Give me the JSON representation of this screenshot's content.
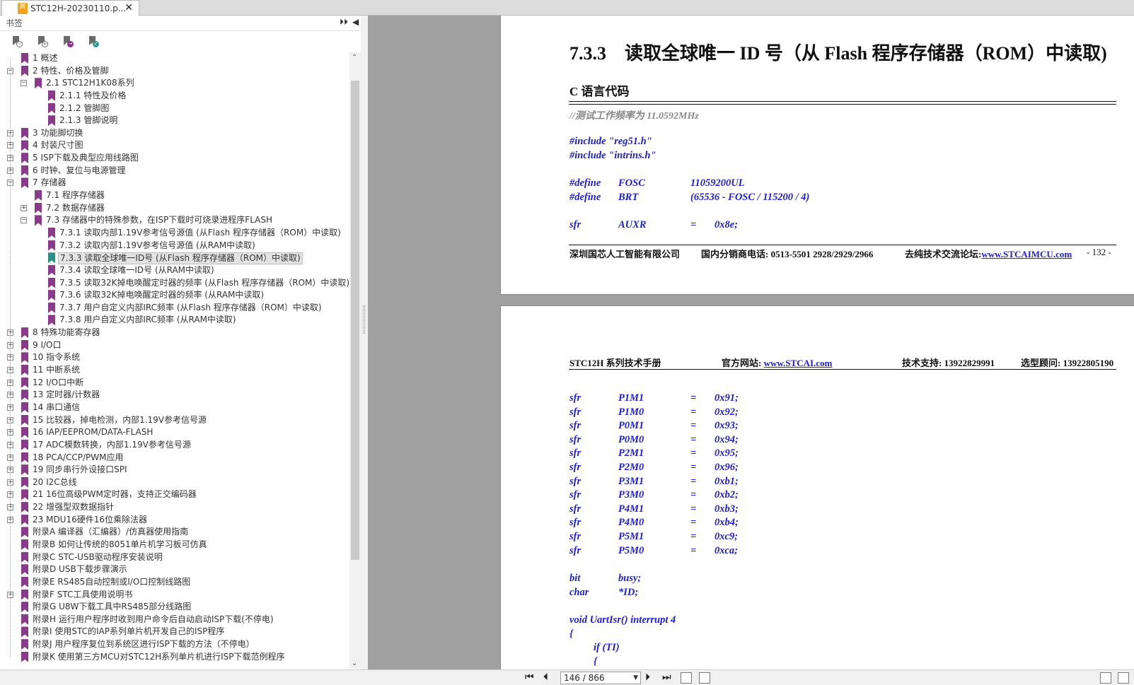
{
  "tab": {
    "title": "STC12H-20230110.p...",
    "icon": "pdf-icon"
  },
  "sidebar": {
    "title": "书签",
    "tree": [
      {
        "label": "1 概述",
        "level": 0,
        "exp": ""
      },
      {
        "label": "2 特性、价格及管脚",
        "level": 0,
        "exp": "−"
      },
      {
        "label": "2.1 STC12H1K08系列",
        "level": 1,
        "exp": "−"
      },
      {
        "label": "2.1.1 特性及价格",
        "level": 2,
        "exp": ""
      },
      {
        "label": "2.1.2 管脚图",
        "level": 2,
        "exp": ""
      },
      {
        "label": "2.1.3 管脚说明",
        "level": 2,
        "exp": ""
      },
      {
        "label": "3 功能脚切换",
        "level": 0,
        "exp": "+"
      },
      {
        "label": "4 封装尺寸图",
        "level": 0,
        "exp": "+"
      },
      {
        "label": "5 ISP下载及典型应用线路图",
        "level": 0,
        "exp": "+"
      },
      {
        "label": "6 时钟、复位与电源管理",
        "level": 0,
        "exp": "+"
      },
      {
        "label": "7 存储器",
        "level": 0,
        "exp": "−"
      },
      {
        "label": "7.1 程序存储器",
        "level": 1,
        "exp": ""
      },
      {
        "label": "7.2 数据存储器",
        "level": 1,
        "exp": "+"
      },
      {
        "label": "7.3 存储器中的特殊参数，在ISP下载时可烧录进程序FLASH",
        "level": 1,
        "exp": "−"
      },
      {
        "label": "7.3.1 读取内部1.19V参考信号源值 (从Flash 程序存储器（ROM）中读取)",
        "level": 2,
        "exp": ""
      },
      {
        "label": "7.3.2 读取内部1.19V参考信号源值 (从RAM中读取)",
        "level": 2,
        "exp": ""
      },
      {
        "label": "7.3.3 读取全球唯一ID号 (从Flash 程序存储器（ROM）中读取)",
        "level": 2,
        "exp": "",
        "selected": true
      },
      {
        "label": "7.3.4 读取全球唯一ID号 (从RAM中读取)",
        "level": 2,
        "exp": ""
      },
      {
        "label": "7.3.5 读取32K掉电唤醒定时器的频率 (从Flash 程序存储器（ROM）中读取)",
        "level": 2,
        "exp": ""
      },
      {
        "label": "7.3.6 读取32K掉电唤醒定时器的频率 (从RAM中读取)",
        "level": 2,
        "exp": ""
      },
      {
        "label": "7.3.7 用户自定义内部IRC频率 (从Flash 程序存储器（ROM）中读取)",
        "level": 2,
        "exp": ""
      },
      {
        "label": "7.3.8 用户自定义内部IRC频率 (从RAM中读取)",
        "level": 2,
        "exp": ""
      },
      {
        "label": "8 特殊功能寄存器",
        "level": 0,
        "exp": "+"
      },
      {
        "label": "9 I/O口",
        "level": 0,
        "exp": "+"
      },
      {
        "label": "10 指令系统",
        "level": 0,
        "exp": "+"
      },
      {
        "label": "11 中断系统",
        "level": 0,
        "exp": "+"
      },
      {
        "label": "12 I/O口中断",
        "level": 0,
        "exp": "+"
      },
      {
        "label": "13 定时器/计数器",
        "level": 0,
        "exp": "+"
      },
      {
        "label": "14 串口通信",
        "level": 0,
        "exp": "+"
      },
      {
        "label": "15 比较器，掉电检测，内部1.19V参考信号源",
        "level": 0,
        "exp": "+"
      },
      {
        "label": "16 IAP/EEPROM/DATA-FLASH",
        "level": 0,
        "exp": "+"
      },
      {
        "label": "17 ADC模数转换，内部1.19V参考信号源",
        "level": 0,
        "exp": "+"
      },
      {
        "label": "18 PCA/CCP/PWM应用",
        "level": 0,
        "exp": "+"
      },
      {
        "label": "19 同步串行外设接口SPI",
        "level": 0,
        "exp": "+"
      },
      {
        "label": "20 I2C总线",
        "level": 0,
        "exp": "+"
      },
      {
        "label": "21 16位高级PWM定时器，支持正交编码器",
        "level": 0,
        "exp": "+"
      },
      {
        "label": "22 增强型双数据指针",
        "level": 0,
        "exp": "+"
      },
      {
        "label": "23 MDU16硬件16位乘除法器",
        "level": 0,
        "exp": "+"
      },
      {
        "label": "附录A 编译器（汇编器）/仿真器使用指南",
        "level": 0,
        "exp": ""
      },
      {
        "label": "附录B 如何让传统的8051单片机学习板可仿真",
        "level": 0,
        "exp": ""
      },
      {
        "label": "附录C STC-USB驱动程序安装说明",
        "level": 0,
        "exp": ""
      },
      {
        "label": "附录D USB下载步骤演示",
        "level": 0,
        "exp": ""
      },
      {
        "label": "附录E RS485自动控制或I/O口控制线路图",
        "level": 0,
        "exp": ""
      },
      {
        "label": "附录F STC工具使用说明书",
        "level": 0,
        "exp": "+"
      },
      {
        "label": "附录G U8W下载工具中RS485部分线路图",
        "level": 0,
        "exp": ""
      },
      {
        "label": "附录H 运行用户程序时收到用户命令后自动启动ISP下载(不停电)",
        "level": 0,
        "exp": ""
      },
      {
        "label": "附录I 使用STC的IAP系列单片机开发自己的ISP程序",
        "level": 0,
        "exp": ""
      },
      {
        "label": "附录J 用户程序复位到系统区进行ISP下载的方法（不停电）",
        "level": 0,
        "exp": ""
      },
      {
        "label": "附录K 使用第三方MCU对STC12H系列单片机进行ISP下载范例程序",
        "level": 0,
        "exp": ""
      }
    ]
  },
  "page1": {
    "heading": "7.3.3　读取全球唯一 ID 号（从 Flash  程序存储器（ROM）中读取)",
    "subheading": "C 语言代码",
    "comment": "//测试工作频率为 11.0592MHz",
    "includes": [
      "#include \"reg51.h\"",
      "#include \"intrins.h\""
    ],
    "defines": [
      {
        "kw": "#define",
        "name": "FOSC",
        "val": "11059200UL"
      },
      {
        "kw": "#define",
        "name": "BRT",
        "val": "(65536 - FOSC / 115200 / 4)"
      }
    ],
    "sfr_auxr": {
      "kw": "sfr",
      "name": "AUXR",
      "eq": "=",
      "val": "0x8e;"
    },
    "footer": {
      "company": "深圳国芯人工智能有限公司",
      "phone_label": "国内分销商电话:",
      "phone": "0513-5501 2928/2929/2966",
      "forum_label": "去纯技术交流论坛:",
      "forum": "www.STCAIMCU.com",
      "pageno": "- 132 -"
    }
  },
  "page2": {
    "header": {
      "manual": "STC12H 系列技术手册",
      "site_label": "官方网站:",
      "site": "www.STCAI.com",
      "support_label": "技术支持:",
      "support": "13922829991",
      "select_label": "选型顾问:",
      "select": "13922805190"
    },
    "sfrs": [
      {
        "kw": "sfr",
        "name": "P1M1",
        "eq": "=",
        "val": "0x91;"
      },
      {
        "kw": "sfr",
        "name": "P1M0",
        "eq": "=",
        "val": "0x92;"
      },
      {
        "kw": "sfr",
        "name": "P0M1",
        "eq": "=",
        "val": "0x93;"
      },
      {
        "kw": "sfr",
        "name": "P0M0",
        "eq": "=",
        "val": "0x94;"
      },
      {
        "kw": "sfr",
        "name": "P2M1",
        "eq": "=",
        "val": "0x95;"
      },
      {
        "kw": "sfr",
        "name": "P2M0",
        "eq": "=",
        "val": "0x96;"
      },
      {
        "kw": "sfr",
        "name": "P3M1",
        "eq": "=",
        "val": "0xb1;"
      },
      {
        "kw": "sfr",
        "name": "P3M0",
        "eq": "=",
        "val": "0xb2;"
      },
      {
        "kw": "sfr",
        "name": "P4M1",
        "eq": "=",
        "val": "0xb3;"
      },
      {
        "kw": "sfr",
        "name": "P4M0",
        "eq": "=",
        "val": "0xb4;"
      },
      {
        "kw": "sfr",
        "name": "P5M1",
        "eq": "=",
        "val": "0xc9;"
      },
      {
        "kw": "sfr",
        "name": "P5M0",
        "eq": "=",
        "val": "0xca;"
      }
    ],
    "vars": [
      {
        "kw": "bit",
        "name": "busy;"
      },
      {
        "kw": "char",
        "name": "*ID;"
      }
    ],
    "func": "void UartIsr() interrupt 4",
    "brace": "{",
    "if_line": "if (TI)",
    "inner_brace": "{"
  },
  "status": {
    "page_input": "146 / 866"
  },
  "colors": {
    "bookmark": "#8a3a8a",
    "bookmark_selected": "#2a8f86",
    "code": "#1d1ddb"
  }
}
